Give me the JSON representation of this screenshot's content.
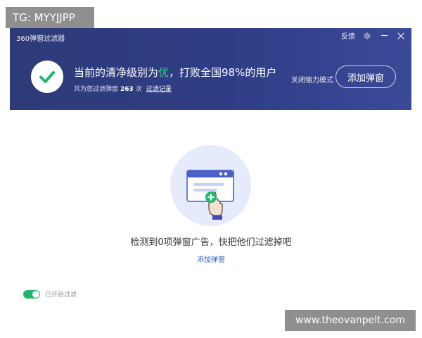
{
  "watermark_top": "TG: MYYJJPP",
  "watermark_bottom": "www.theovanpelt.com",
  "header": {
    "app_title": "360弹窗过滤器",
    "feedback_label": "反馈",
    "status_prefix": "当前的清净级别为",
    "status_level": "优",
    "status_suffix": "，打败全国98%的用户",
    "sub_prefix": "共为您过滤弹窗",
    "filtered_count": "263",
    "sub_unit": "次",
    "filter_log_link": "过滤记录",
    "strong_mode_label": "关闭强力模式",
    "add_button_label": "添加弹窗"
  },
  "main": {
    "empty_message": "检测到0项弹窗广告，快把他们过滤掉吧",
    "add_link": "添加弹窗"
  },
  "footer": {
    "toggle_label": "已开启过滤",
    "toggle_on": true
  },
  "colors": {
    "header_bg": "#2f3d86",
    "accent_green": "#1fb76a",
    "link_blue": "#2f5fd0"
  },
  "icons": [
    "check-icon",
    "gear-icon",
    "minimize-icon",
    "close-icon",
    "popup-window-icon",
    "hand-pointer-icon",
    "plus-icon"
  ]
}
